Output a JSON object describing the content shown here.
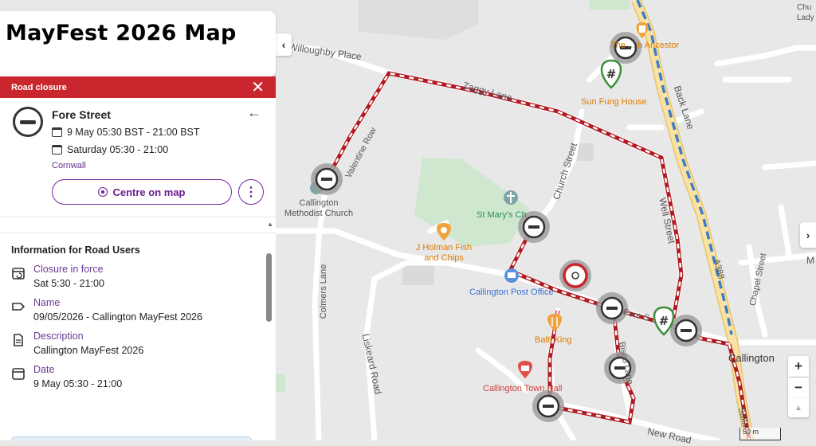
{
  "page_title": "MayFest 2026 Map",
  "panel": {
    "header": "Road closure",
    "close_icon": "close-icon",
    "street": "Fore Street",
    "date_range": "9 May 05:30 BST - 21:00 BST",
    "recurrence": "Saturday 05:30 - 21:00",
    "county": "Cornwall",
    "centre_button": "Centre on map",
    "more_icon": "more-vertical-icon",
    "section_title": "Information for Road Users",
    "rows": [
      {
        "icon": "calendar-repeat-icon",
        "label": "Closure in force",
        "value": "Sat 5:30 - 21:00"
      },
      {
        "icon": "tag-icon",
        "label": "Name",
        "value": "09/05/2026 - Callington MayFest 2026"
      },
      {
        "icon": "document-icon",
        "label": "Description",
        "value": "Callington MayFest 2026"
      },
      {
        "icon": "calendar-icon",
        "label": "Date",
        "value": "9 May 05:30 - 21:00"
      }
    ]
  },
  "map": {
    "labels": {
      "willoughby": "Willoughby Place",
      "zaggy": "Zaggy Lane",
      "valentine": "Valentine Row",
      "church_st": "Church Street",
      "well_st": "Well Street",
      "back_lane": "Back Lane",
      "a388": "A388",
      "chapel_st": "Chapel Street",
      "colmers": "Colmers Lane",
      "liskeard": "Liskeard Road",
      "bisco": "Bisco Lane",
      "fore_st": "Fore S",
      "new_road": "New Road",
      "salta": "Salta",
      "callington": "Callington",
      "church_lady": "Chu Lady",
      "methodist": "Callington Methodist Church",
      "st_marys": "St Mary's Ch",
      "holman": "J Holman Fish and Chips",
      "post_office": "Callington Post Office",
      "balti": "Balti King",
      "town_hall": "Callington Town Hall",
      "sun_fung": "Sun Fung House",
      "ancestor": "The ... h Ancestor",
      "m_edge": "M"
    },
    "zoom_in": "+",
    "zoom_out": "−",
    "scale": "50 m",
    "collapse_icon": "chevron-left-icon",
    "expand_icon": "chevron-right-icon",
    "compass_icon": "compass-icon"
  },
  "colors": {
    "closure_red": "#b11a22",
    "header_red": "#c9262d",
    "purple": "#6b1f8f",
    "road_yellow": "#f7d98a",
    "route_blue": "#3a7dc9"
  }
}
